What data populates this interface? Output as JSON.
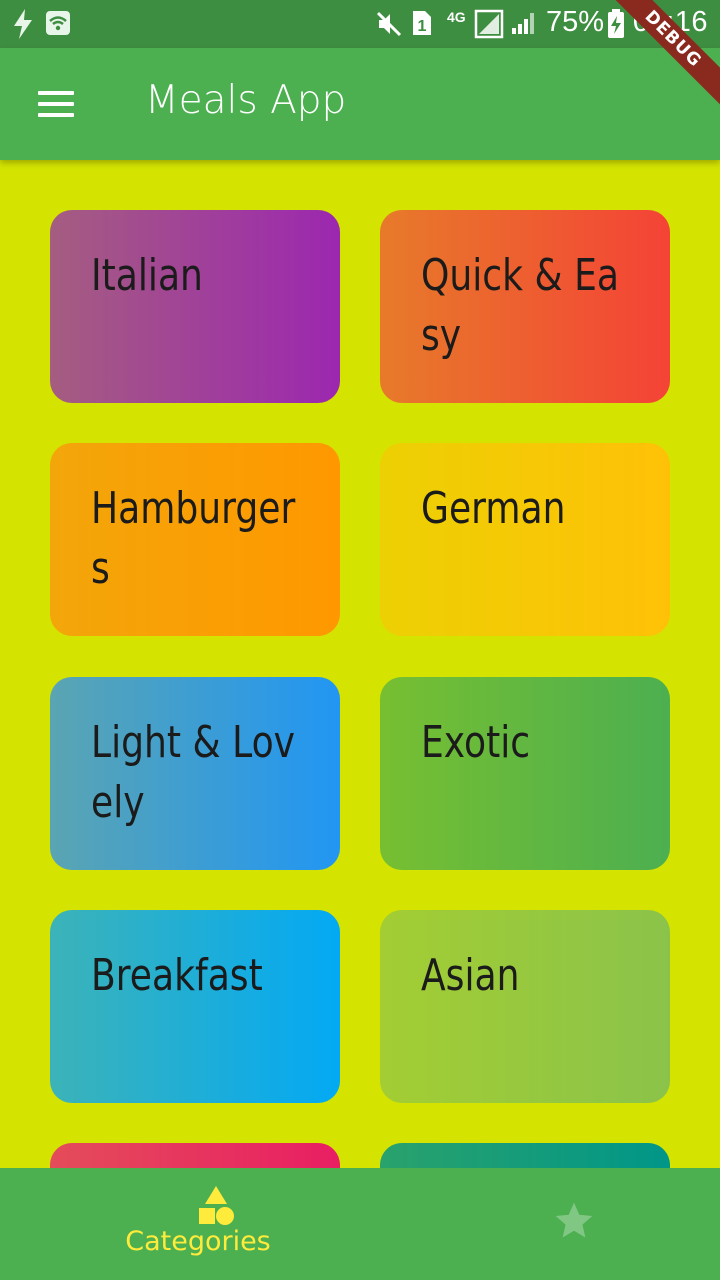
{
  "status_bar": {
    "battery_percent": "75%",
    "time": "05:16",
    "network": "4G",
    "sim_slot": "1"
  },
  "debug_banner": {
    "label": "DEBUG"
  },
  "app_bar": {
    "title": "Meals App",
    "menu_icon": "menu-icon"
  },
  "categories": [
    {
      "title": "Italian",
      "color_from": "#a55d80",
      "color_to": "#9c27b0"
    },
    {
      "title": "Quick & Easy",
      "color_from": "#e77a2a",
      "color_to": "#f44336"
    },
    {
      "title": "Hamburgers",
      "color_from": "#f3a60a",
      "color_to": "#ff9800"
    },
    {
      "title": "German",
      "color_from": "#ecd004",
      "color_to": "#ffc107"
    },
    {
      "title": "Light & Lovely",
      "color_from": "#5aa5b2",
      "color_to": "#2196f3"
    },
    {
      "title": "Exotic",
      "color_from": "#77bf31",
      "color_to": "#4caf50"
    },
    {
      "title": "Breakfast",
      "color_from": "#3cb3b8",
      "color_to": "#03a9f4"
    },
    {
      "title": "Asian",
      "color_from": "#a3cd33",
      "color_to": "#8bc34a"
    },
    {
      "title": "",
      "color_from": "#e44c5a",
      "color_to": "#e91e63"
    },
    {
      "title": "",
      "color_from": "#2aa26c",
      "color_to": "#009688"
    }
  ],
  "bottom_nav": {
    "items": [
      {
        "label": "Categories",
        "icon": "category-shapes-icon",
        "active": true,
        "color": "#ffeb3b"
      },
      {
        "label": "",
        "icon": "star-icon",
        "active": false,
        "color": "#81c784"
      }
    ]
  }
}
